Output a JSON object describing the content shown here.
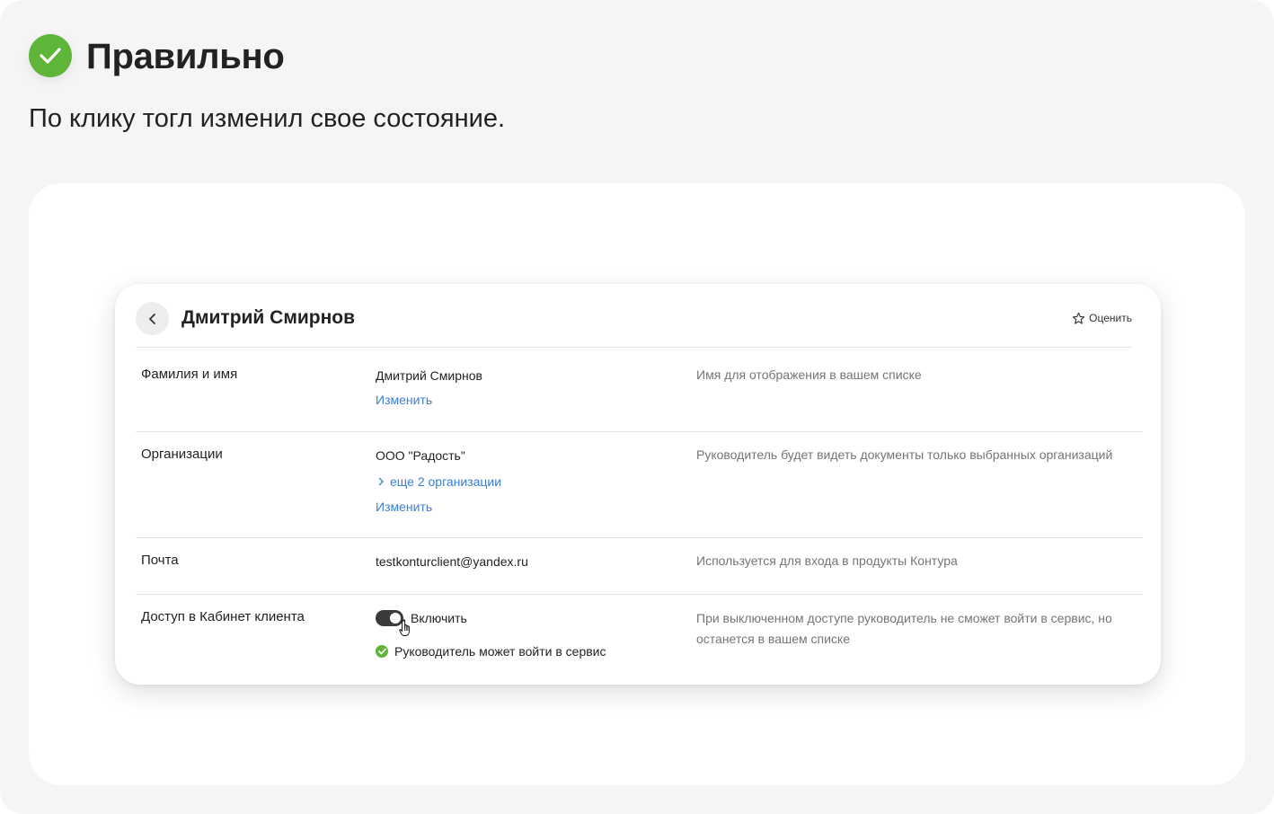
{
  "verdict": {
    "icon": "check-circle-icon",
    "title": "Правильно",
    "description": "По клику тогл изменил свое состояние.",
    "accent_color": "#5fb43a"
  },
  "card": {
    "back_icon": "chevron-left-icon",
    "title": "Дмитрий Смирнов",
    "rate": {
      "icon": "star-icon",
      "label": "Оценить"
    },
    "rows": {
      "name": {
        "label": "Фамилия и имя",
        "value": "Дмитрий Смирнов",
        "link": "Изменить",
        "hint": "Имя для отображения в вашем списке"
      },
      "orgs": {
        "label": "Организации",
        "value": "ООО \"Радость\"",
        "more_link": "еще 2 организации",
        "link": "Изменить",
        "hint": "Руководитель будет видеть документы только выбранных организаций"
      },
      "email": {
        "label": "Почта",
        "value": "testkonturclient@yandex.ru",
        "hint": "Используется для входа в продукты Контура"
      },
      "access": {
        "label": "Доступ в Кабинет клиента",
        "toggle_label": "Включить",
        "toggle_on": true,
        "status": "Руководитель может войти в сервис",
        "status_icon": "check-circle-icon",
        "hint": "При выключенном доступе руководитель не сможет войти в сервис, но останется в вашем списке"
      }
    },
    "link_color": "#3b7ed4",
    "toggle_color": "#3b3b3b"
  },
  "cursor_icon": "hand-pointer-icon"
}
